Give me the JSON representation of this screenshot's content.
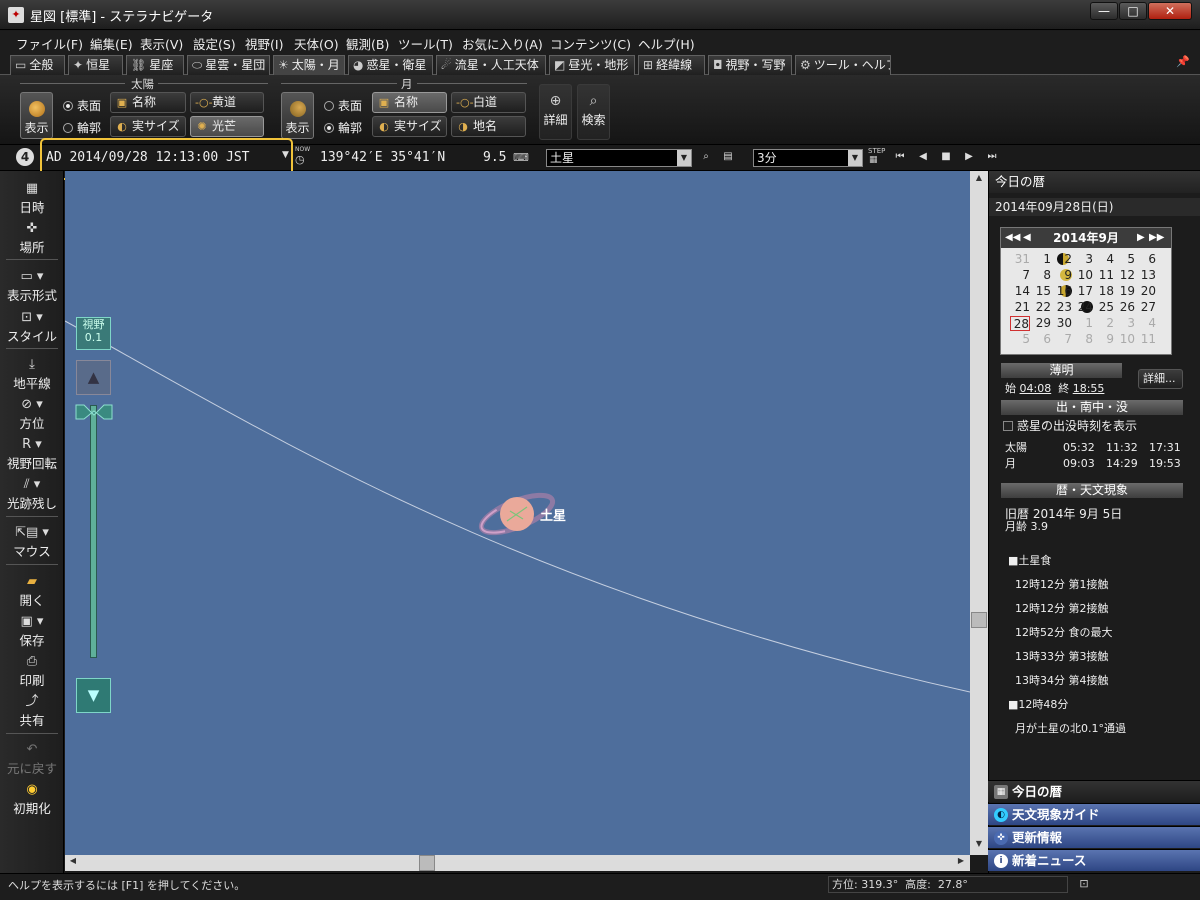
{
  "window": {
    "title": "星図 [標準] - ステラナビゲータ",
    "app_icon": "telescope-icon"
  },
  "window_buttons": {
    "minimize": "—",
    "maximize": "□",
    "close": "✕"
  },
  "menu": [
    "ファイル(F)",
    "編集(E)",
    "表示(V)",
    "設定(S)",
    "視野(I)",
    "天体(O)",
    "観測(B)",
    "ツール(T)",
    "お気に入り(A)",
    "コンテンツ(C)",
    "ヘルプ(H)"
  ],
  "tabs": [
    {
      "label": "全般",
      "icon": "window-icon",
      "glyph": "▭"
    },
    {
      "label": "恒星",
      "icon": "star-icon",
      "glyph": "✦"
    },
    {
      "label": "星座",
      "icon": "constellation-icon",
      "glyph": "⛓"
    },
    {
      "label": "星雲・星団",
      "icon": "nebula-icon",
      "glyph": "⬭"
    },
    {
      "label": "太陽・月",
      "icon": "sun-icon",
      "glyph": "☀",
      "active": true
    },
    {
      "label": "惑星・衛星",
      "icon": "planet-icon",
      "glyph": "◕"
    },
    {
      "label": "流星・人工天体",
      "icon": "meteor-icon",
      "glyph": "☄"
    },
    {
      "label": "昼光・地形",
      "icon": "landscape-icon",
      "glyph": "◩"
    },
    {
      "label": "経緯線",
      "icon": "grid-icon",
      "glyph": "⊞"
    },
    {
      "label": "視野・写野",
      "icon": "camera-icon",
      "glyph": "◘"
    },
    {
      "label": "ツール・ヘルプ",
      "icon": "gear-icon",
      "glyph": "⚙"
    }
  ],
  "ribbon": {
    "sun": {
      "group_title": "太陽",
      "display": "表示",
      "surface": "表面",
      "outline": "輪郭",
      "name": "名称",
      "ecliptic": "黄道",
      "real_size": "実サイズ",
      "corona": "光芒"
    },
    "moon": {
      "group_title": "月",
      "display": "表示",
      "surface": "表面",
      "outline": "輪郭",
      "name": "名称",
      "white_path": "白道",
      "real_size": "実サイズ",
      "place_name": "地名"
    },
    "detail": "詳細",
    "search": "検索"
  },
  "status": {
    "number": "4",
    "datetime": "AD 2014/09/28 12:13:00 JST",
    "now_label": "NOW",
    "location": "139°42′E 35°41′N",
    "magnitude": "9.5",
    "target": "土星",
    "step_value": "3分",
    "step_label": "STEP"
  },
  "left_toolbar": {
    "datetime": "日時",
    "place": "場所",
    "display_format": "表示形式",
    "style": "スタイル",
    "horizon": "地平線",
    "direction": "方位",
    "rotate": "視野回転",
    "trail": "光跡残し",
    "mouse": "マウス",
    "open": "開く",
    "save": "保存",
    "print": "印刷",
    "share": "共有",
    "undo": "元に戻す",
    "reset": "初期化"
  },
  "sky": {
    "fov_label": "視野",
    "fov_value": "0.1",
    "object_label": "土星"
  },
  "right_panel": {
    "title": "今日の暦",
    "date": "2014年09月28日(日)",
    "calendar": {
      "title": "2014年9月",
      "rows": [
        [
          {
            "d": "31",
            "o": true
          },
          {
            "d": "1"
          },
          {
            "d": "2"
          },
          {
            "d": "3"
          },
          {
            "d": "4"
          },
          {
            "d": "5"
          },
          {
            "d": "6"
          }
        ],
        [
          {
            "d": "7"
          },
          {
            "d": "8"
          },
          {
            "d": "9"
          },
          {
            "d": "10"
          },
          {
            "d": "11"
          },
          {
            "d": "12"
          },
          {
            "d": "13"
          }
        ],
        [
          {
            "d": "14"
          },
          {
            "d": "15"
          },
          {
            "d": "16"
          },
          {
            "d": "17"
          },
          {
            "d": "18"
          },
          {
            "d": "19"
          },
          {
            "d": "20"
          }
        ],
        [
          {
            "d": "21"
          },
          {
            "d": "22"
          },
          {
            "d": "23"
          },
          {
            "d": "24"
          },
          {
            "d": "25"
          },
          {
            "d": "26"
          },
          {
            "d": "27"
          }
        ],
        [
          {
            "d": "28",
            "t": true
          },
          {
            "d": "29"
          },
          {
            "d": "30"
          },
          {
            "d": "1",
            "o": true
          },
          {
            "d": "2",
            "o": true
          },
          {
            "d": "3",
            "o": true
          },
          {
            "d": "4",
            "o": true
          }
        ],
        [
          {
            "d": "5",
            "o": true
          },
          {
            "d": "6",
            "o": true
          },
          {
            "d": "7",
            "o": true
          },
          {
            "d": "8",
            "o": true
          },
          {
            "d": "9",
            "o": true
          },
          {
            "d": "10",
            "o": true
          },
          {
            "d": "11",
            "o": true
          }
        ]
      ]
    },
    "twilight": {
      "title": "薄明",
      "start_label": "始",
      "start": "04:08",
      "end_label": "終",
      "end": "18:55",
      "detail_button": "詳細..."
    },
    "rise_set": {
      "title": "出・南中・没",
      "checkbox": "惑星の出没時刻を表示",
      "rows": [
        {
          "name": "太陽",
          "rise": "05:32",
          "transit": "11:32",
          "set": "17:31"
        },
        {
          "name": "月",
          "rise": "09:03",
          "transit": "14:29",
          "set": "19:53"
        }
      ]
    },
    "events": {
      "title": "暦・天文現象",
      "lunar_date": "旧暦 2014年 9月 5日",
      "moon_age": "月齢 3.9",
      "lines": [
        "■土星食",
        "  12時12分 第1接触",
        "  12時12分 第2接触",
        "  12時52分 食の最大",
        "  13時33分 第3接触",
        "  13時34分 第4接触",
        "■12時48分",
        "  月が土星の北0.1°通過"
      ]
    },
    "nav": [
      "今日の暦",
      "天文現象ガイド",
      "更新情報",
      "新着ニュース"
    ]
  },
  "bottom": {
    "help_text": "ヘルプを表示するには [F1] を押してください。",
    "azimuth": "方位: 319.3°  高度:  27.8°"
  }
}
